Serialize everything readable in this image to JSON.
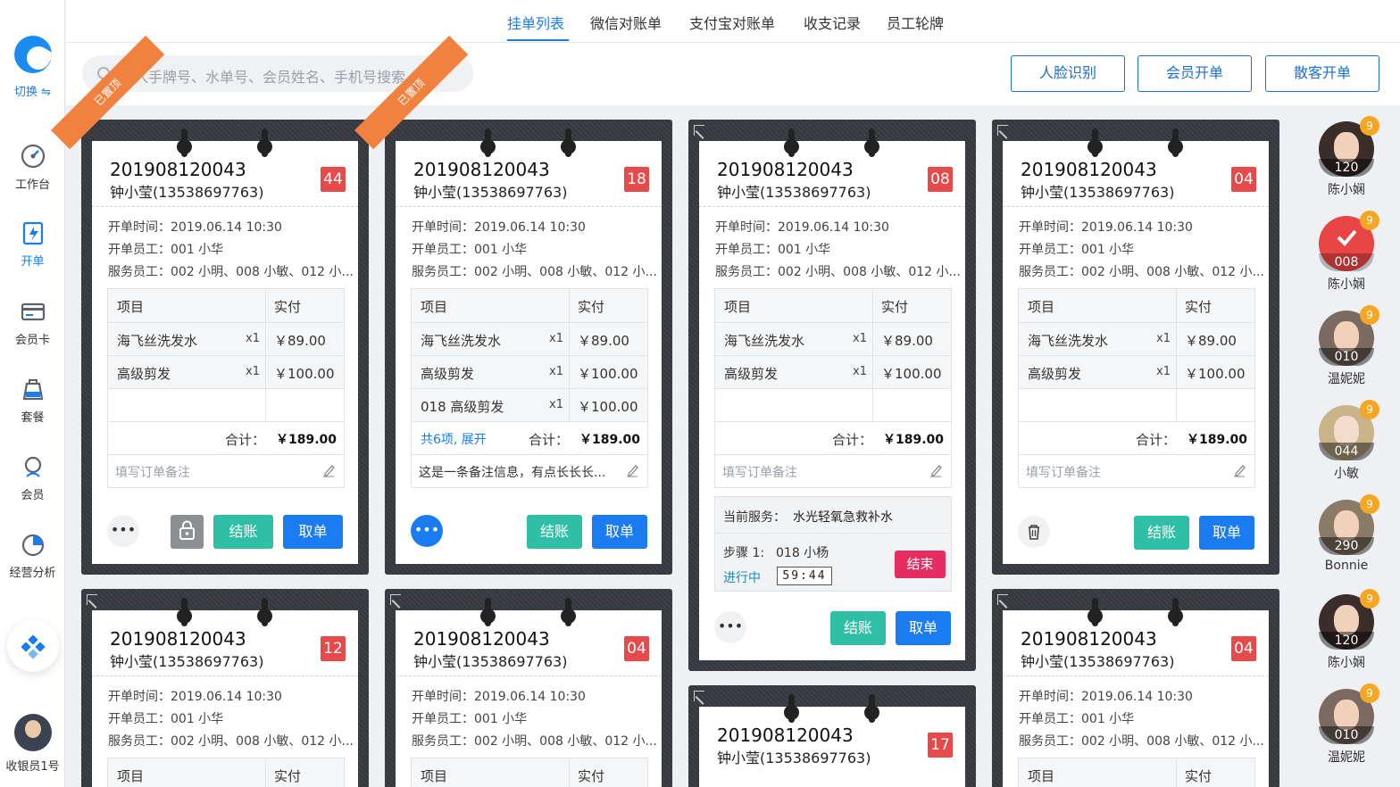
{
  "sidebar": {
    "switch_label": "切换 ⇋",
    "items": [
      {
        "label": "工作台",
        "icon": "dashboard-icon"
      },
      {
        "label": "开单",
        "icon": "open-order-icon"
      },
      {
        "label": "会员卡",
        "icon": "member-card-icon"
      },
      {
        "label": "套餐",
        "icon": "package-icon"
      },
      {
        "label": "会员",
        "icon": "member-icon"
      },
      {
        "label": "经营分析",
        "icon": "analysis-icon"
      }
    ],
    "user_label": "收银员1号"
  },
  "tabs": [
    "挂单列表",
    "微信对账单",
    "支付宝对账单",
    "收支记录",
    "员工轮牌"
  ],
  "search": {
    "placeholder": "输入手牌号、水单号、会员姓名、手机号搜索"
  },
  "actions": {
    "face": "人脸识别",
    "member": "会员开单",
    "guest": "散客开单"
  },
  "labels": {
    "item": "项目",
    "paid": "实付",
    "total": "合计：",
    "remark_placeholder": "填写订单备注",
    "checkout": "结账",
    "cancel": "取单",
    "more": "•••",
    "pinned": "已置顶",
    "current_service": "当前服务：",
    "end": "结束",
    "in_progress": "进行中"
  },
  "cards": [
    {
      "order_no": "201908120043",
      "customer": "钟小莹(13538697763)",
      "badge": "44",
      "pinned": true,
      "open_time": "开单时间：2019.06.14 10:30",
      "open_staff": "开单员工：001 小华",
      "service_staff": "服务员工：002 小明、008 小敏、012 小...",
      "rows": [
        {
          "name": "海飞丝洗发水",
          "qty": "x1",
          "price": "￥89.00"
        },
        {
          "name": "高级剪发",
          "qty": "x1",
          "price": "￥100.00"
        },
        {
          "name": "",
          "qty": "",
          "price": ""
        }
      ],
      "total": "￥189.00",
      "remark": ""
    },
    {
      "order_no": "201908120043",
      "customer": "钟小莹(13538697763)",
      "badge": "18",
      "pinned": true,
      "open_time": "开单时间：2019.06.14 10:30",
      "open_staff": "开单员工：001 小华",
      "service_staff": "服务员工：002 小明、008 小敏、012 小...",
      "rows": [
        {
          "name": "海飞丝洗发水",
          "qty": "x1",
          "price": "￥89.00"
        },
        {
          "name": "高级剪发",
          "qty": "x1",
          "price": "￥100.00"
        },
        {
          "name": "018 高级剪发",
          "qty": "x1",
          "price": "￥100.00"
        }
      ],
      "expand": "共6项, 展开",
      "total": "￥189.00",
      "remark": "这是一条备注信息，有点长长长..."
    },
    {
      "order_no": "201908120043",
      "customer": "钟小莹(13538697763)",
      "badge": "08",
      "pinned": false,
      "open_time": "开单时间：2019.06.14 10:30",
      "open_staff": "开单员工：001 小华",
      "service_staff": "服务员工：002 小明、008 小敏、012 小...",
      "rows": [
        {
          "name": "海飞丝洗发水",
          "qty": "x1",
          "price": "￥89.00"
        },
        {
          "name": "高级剪发",
          "qty": "x1",
          "price": "￥100.00"
        },
        {
          "name": "",
          "qty": "",
          "price": ""
        }
      ],
      "total": "￥189.00",
      "remark": "",
      "service": {
        "name": "水光轻氧急救补水",
        "step": "步骤 1:",
        "staff": "018 小杨",
        "timer": "59:44"
      }
    },
    {
      "order_no": "201908120043",
      "customer": "钟小莹(13538697763)",
      "badge": "04",
      "pinned": false,
      "open_time": "开单时间：2019.06.14 10:30",
      "open_staff": "开单员工：001 小华",
      "service_staff": "服务员工：002 小明、008 小敏、012 小...",
      "rows": [
        {
          "name": "海飞丝洗发水",
          "qty": "x1",
          "price": "￥89.00"
        },
        {
          "name": "高级剪发",
          "qty": "x1",
          "price": "￥100.00"
        },
        {
          "name": "",
          "qty": "",
          "price": ""
        }
      ],
      "total": "￥189.00",
      "remark": ""
    },
    {
      "order_no": "201908120043",
      "customer": "钟小莹(13538697763)",
      "badge": "12",
      "open_time": "开单时间：2019.06.14 10:30",
      "open_staff": "开单员工：001 小华",
      "service_staff": "服务员工：002 小明、008 小敏、012 小..."
    },
    {
      "order_no": "201908120043",
      "customer": "钟小莹(13538697763)",
      "badge": "04",
      "open_time": "开单时间：2019.06.14 10:30",
      "open_staff": "开单员工：001 小华",
      "service_staff": "服务员工：002 小明、008 小敏、012 小..."
    },
    {
      "order_no": "201908120043",
      "customer": "钟小莹(13538697763)",
      "badge": "17"
    },
    {
      "order_no": "201908120043",
      "customer": "钟小莹(13538697763)",
      "badge": "04",
      "open_time": "开单时间：2019.06.14 10:30",
      "open_staff": "开单员工：001 小华",
      "service_staff": "服务员工：002 小明、008 小敏、012 小..."
    }
  ],
  "staff": [
    {
      "name": "陈小娴",
      "num": "120",
      "count": "9"
    },
    {
      "name": "陈小娴",
      "num": "008",
      "count": "9",
      "selected": true
    },
    {
      "name": "温妮妮",
      "num": "010",
      "count": "9"
    },
    {
      "name": "小敏",
      "num": "044",
      "count": "9"
    },
    {
      "name": "Bonnie",
      "num": "290",
      "count": "9"
    },
    {
      "name": "陈小娴",
      "num": "120",
      "count": "9"
    },
    {
      "name": "温妮妮",
      "num": "010",
      "count": "9"
    }
  ],
  "colors": {
    "accent": "#1a7cf0",
    "teal": "#2fbfa7",
    "badge": "#e64a4a",
    "ribbon": "#f0813e",
    "end": "#e62d60",
    "dot": "#f5a623"
  }
}
